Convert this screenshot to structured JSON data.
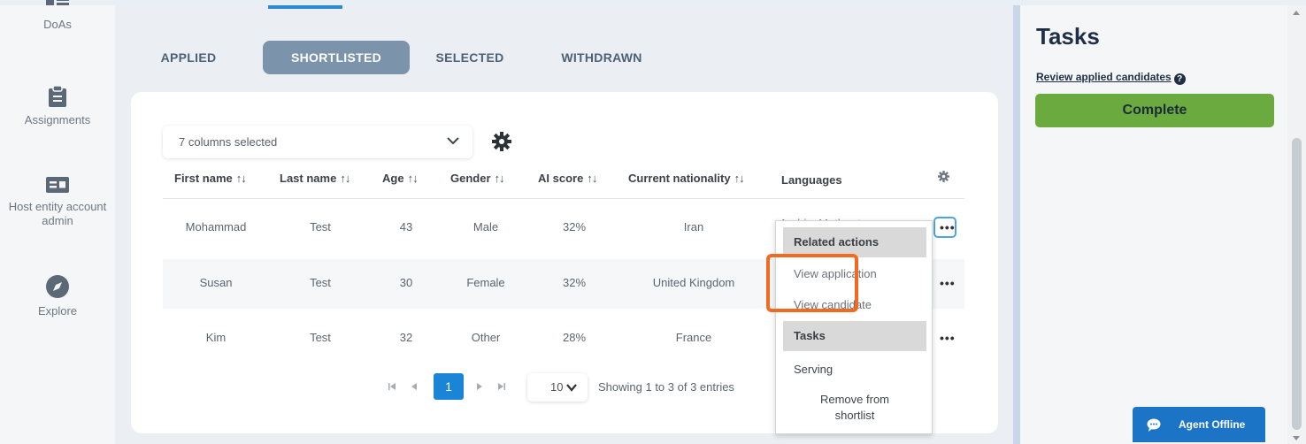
{
  "nav": {
    "items": [
      {
        "label": "DoAs",
        "icon": "list-icon"
      },
      {
        "label": "Assignments",
        "icon": "clipboard-icon"
      },
      {
        "label": "Host entity account admin",
        "icon": "id-card-icon"
      },
      {
        "label": "Explore",
        "icon": "compass-icon"
      }
    ]
  },
  "tabs": [
    "APPLIED",
    "SHORTLISTED",
    "SELECTED",
    "WITHDRAWN"
  ],
  "active_tab": "SHORTLISTED",
  "column_select": {
    "value": "7 columns selected"
  },
  "columns": [
    "First name",
    "Last name",
    "Age",
    "Gender",
    "AI score",
    "Current nationality",
    "Languages"
  ],
  "sort_glyph": "↑↓",
  "partial_language_text": "Arabic, Mother tongue",
  "rows": [
    {
      "first": "Mohammad",
      "last": "Test",
      "age": "43",
      "gender": "Male",
      "score": "32%",
      "nationality": "Iran"
    },
    {
      "first": "Susan",
      "last": "Test",
      "age": "30",
      "gender": "Female",
      "score": "32%",
      "nationality": "United Kingdom"
    },
    {
      "first": "Kim",
      "last": "Test",
      "age": "32",
      "gender": "Other",
      "score": "28%",
      "nationality": "France"
    }
  ],
  "row_actions": "•••",
  "pagination": {
    "current": "1",
    "per_page": "10",
    "summary": "Showing 1 to 3 of 3 entries"
  },
  "menu": {
    "related_header": "Related actions",
    "view_application": "View application",
    "view_candidate": "View candidate",
    "tasks_header": "Tasks",
    "serving": "Serving",
    "remove_line1": "Remove from",
    "remove_line2": "shortlist"
  },
  "tasks_panel": {
    "title": "Tasks",
    "review_link": "Review applied candidates",
    "help": "?",
    "complete": "Complete"
  },
  "chat": {
    "label": "Agent Offline"
  },
  "colors": {
    "accent": "#1a85d6",
    "complete": "#6aaa3f",
    "highlight": "#f26a21",
    "active_tab": "#7b93ab"
  }
}
